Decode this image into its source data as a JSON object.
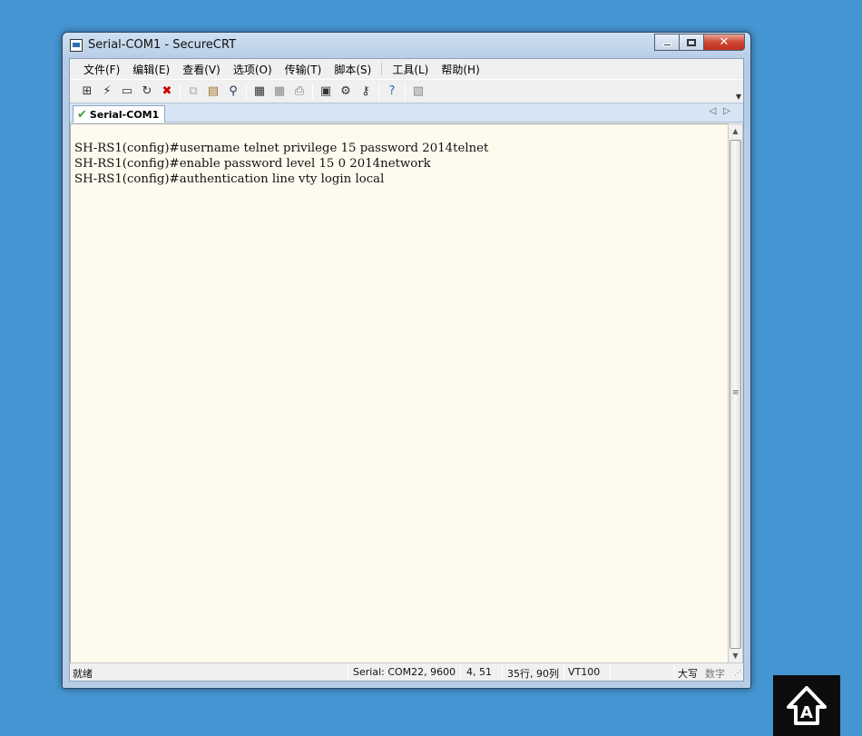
{
  "window": {
    "title": "Serial-COM1 - SecureCRT",
    "buttons": {
      "minimize": "minimize",
      "maximize": "maximize",
      "close": "✕"
    }
  },
  "menu": [
    "文件(F)",
    "编辑(E)",
    "查看(V)",
    "选项(O)",
    "传输(T)",
    "脚本(S)",
    "工具(L)",
    "帮助(H)"
  ],
  "toolbar": {
    "icons": [
      "connect-icon",
      "quick-connect-icon",
      "connect-tab-icon",
      "reconnect-icon",
      "disconnect-icon",
      "copy-icon",
      "paste-icon",
      "find-icon",
      "print-icon",
      "print-preview-icon",
      "printer-icon",
      "session-options-icon",
      "global-options-icon",
      "keymap-icon",
      "help-icon",
      "sftp-icon"
    ]
  },
  "tabs": [
    {
      "label": "Serial-COM1",
      "status": "connected"
    }
  ],
  "terminal": {
    "lines": [
      "SH-RS1(config)#username telnet privilege 15 password 2014telnet",
      "SH-RS1(config)#enable password level 15 0 2014network",
      "SH-RS1(config)#authentication line vty login local"
    ],
    "background": "#fffaee"
  },
  "status": {
    "ready": "就绪",
    "connection": "Serial: COM22, 9600",
    "cursor": "4,  51",
    "size": "35行, 90列",
    "emulation": "VT100",
    "caps": "大写",
    "num": "数字"
  },
  "colors": {
    "desktop": "#4595d2",
    "close_button": "#c0301f"
  }
}
